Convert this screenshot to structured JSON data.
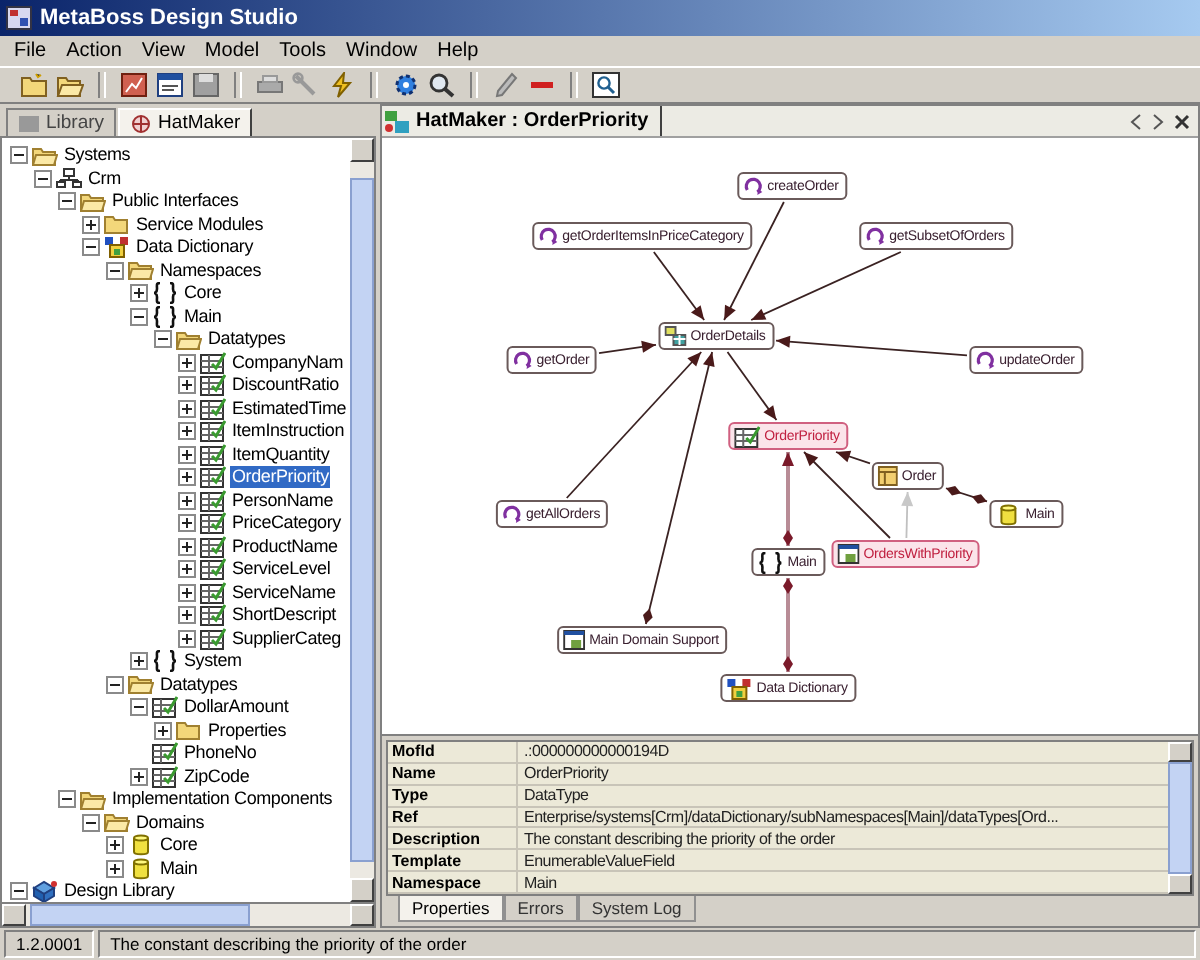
{
  "window": {
    "title": "MetaBoss Design Studio"
  },
  "menu": [
    "File",
    "Action",
    "View",
    "Model",
    "Tools",
    "Window",
    "Help"
  ],
  "left_tabs": [
    {
      "label": "Library",
      "selected": false
    },
    {
      "label": "HatMaker",
      "selected": true
    }
  ],
  "tree": [
    {
      "label": "Systems",
      "kind": "folder",
      "expanded": true,
      "selected": false,
      "children": [
        {
          "label": "Crm",
          "kind": "server",
          "expanded": true,
          "selected": false,
          "children": [
            {
              "label": "Public Interfaces",
              "kind": "folder",
              "expanded": true,
              "selected": false,
              "children": [
                {
                  "label": "Service Modules",
                  "kind": "folder",
                  "expanded": false,
                  "selected": false
                },
                {
                  "label": "Data Dictionary",
                  "kind": "dictionary",
                  "expanded": true,
                  "selected": false,
                  "children": [
                    {
                      "label": "Namespaces",
                      "kind": "folder",
                      "expanded": true,
                      "selected": false,
                      "children": [
                        {
                          "label": "Core",
                          "kind": "namespace",
                          "expanded": false,
                          "selected": false
                        },
                        {
                          "label": "Main",
                          "kind": "namespace",
                          "expanded": true,
                          "selected": false,
                          "children": [
                            {
                              "label": "Datatypes",
                              "kind": "folder",
                              "expanded": true,
                              "selected": false,
                              "children": [
                                {
                                  "label": "CompanyNam",
                                  "kind": "datatype",
                                  "expanded": false,
                                  "selected": false
                                },
                                {
                                  "label": "DiscountRatio",
                                  "kind": "datatype",
                                  "expanded": false,
                                  "selected": false
                                },
                                {
                                  "label": "EstimatedTime",
                                  "kind": "datatype",
                                  "expanded": false,
                                  "selected": false
                                },
                                {
                                  "label": "ItemInstruction",
                                  "kind": "datatype",
                                  "expanded": false,
                                  "selected": false
                                },
                                {
                                  "label": "ItemQuantity",
                                  "kind": "datatype",
                                  "expanded": false,
                                  "selected": false
                                },
                                {
                                  "label": "OrderPriority",
                                  "kind": "datatype",
                                  "expanded": false,
                                  "selected": true
                                },
                                {
                                  "label": "PersonName",
                                  "kind": "datatype",
                                  "expanded": false,
                                  "selected": false
                                },
                                {
                                  "label": "PriceCategory",
                                  "kind": "datatype",
                                  "expanded": false,
                                  "selected": false
                                },
                                {
                                  "label": "ProductName",
                                  "kind": "datatype",
                                  "expanded": false,
                                  "selected": false
                                },
                                {
                                  "label": "ServiceLevel",
                                  "kind": "datatype",
                                  "expanded": false,
                                  "selected": false
                                },
                                {
                                  "label": "ServiceName",
                                  "kind": "datatype",
                                  "expanded": false,
                                  "selected": false
                                },
                                {
                                  "label": "ShortDescript",
                                  "kind": "datatype",
                                  "expanded": false,
                                  "selected": false
                                },
                                {
                                  "label": "SupplierCateg",
                                  "kind": "datatype",
                                  "expanded": false,
                                  "selected": false
                                }
                              ]
                            }
                          ]
                        },
                        {
                          "label": "System",
                          "kind": "namespace",
                          "expanded": false,
                          "selected": false
                        }
                      ]
                    },
                    {
                      "label": "Datatypes",
                      "kind": "folder",
                      "expanded": true,
                      "selected": false,
                      "children": [
                        {
                          "label": "DollarAmount",
                          "kind": "datatype",
                          "expanded": true,
                          "selected": false,
                          "children": [
                            {
                              "label": "Properties",
                              "kind": "folder",
                              "expanded": false,
                              "selected": false
                            }
                          ]
                        },
                        {
                          "label": "PhoneNo",
                          "kind": "datatype",
                          "selected": false
                        },
                        {
                          "label": "ZipCode",
                          "kind": "datatype",
                          "expanded": false,
                          "selected": false
                        }
                      ]
                    }
                  ]
                }
              ]
            },
            {
              "label": "Implementation Components",
              "kind": "folder",
              "expanded": true,
              "selected": false,
              "children": [
                {
                  "label": "Domains",
                  "kind": "folder",
                  "expanded": true,
                  "selected": false,
                  "children": [
                    {
                      "label": "Core",
                      "kind": "database",
                      "expanded": false,
                      "selected": false
                    },
                    {
                      "label": "Main",
                      "kind": "database",
                      "expanded": false,
                      "selected": false
                    }
                  ]
                }
              ]
            }
          ]
        }
      ]
    },
    {
      "label": "Design Library",
      "kind": "library",
      "expanded": true,
      "selected": false
    }
  ],
  "editor": {
    "title": "HatMaker : OrderPriority",
    "nodes": [
      {
        "label": "createOrder",
        "kind": "operation",
        "highlighted": false
      },
      {
        "label": "getOrderItemsInPriceCategory",
        "kind": "operation",
        "highlighted": false
      },
      {
        "label": "getSubsetOfOrders",
        "kind": "operation",
        "highlighted": false
      },
      {
        "label": "OrderDetails",
        "kind": "entity",
        "highlighted": false
      },
      {
        "label": "getOrder",
        "kind": "operation",
        "highlighted": false
      },
      {
        "label": "updateOrder",
        "kind": "operation",
        "highlighted": false
      },
      {
        "label": "OrderPriority",
        "kind": "datatype",
        "highlighted": true
      },
      {
        "label": "Order",
        "kind": "domain-object",
        "highlighted": false
      },
      {
        "label": "Main",
        "kind": "database",
        "highlighted": false
      },
      {
        "label": "getAllOrders",
        "kind": "operation",
        "highlighted": false
      },
      {
        "label": "Main",
        "kind": "namespace",
        "highlighted": false
      },
      {
        "label": "OrdersWithPriority",
        "kind": "component",
        "highlighted": true
      },
      {
        "label": "Main Domain Support",
        "kind": "component",
        "highlighted": false
      },
      {
        "label": "Data Dictionary",
        "kind": "dictionary",
        "highlighted": false
      }
    ]
  },
  "properties": {
    "rows": [
      {
        "name": "MofId",
        "value": ".:000000000000194D"
      },
      {
        "name": "Name",
        "value": "OrderPriority"
      },
      {
        "name": "Type",
        "value": "DataType"
      },
      {
        "name": "Ref",
        "value": "Enterprise/systems[Crm]/dataDictionary/subNamespaces[Main]/dataTypes[Ord..."
      },
      {
        "name": "Description",
        "value": "The constant describing the priority of the order"
      },
      {
        "name": "Template",
        "value": "EnumerableValueField"
      },
      {
        "name": "Namespace",
        "value": "Main"
      }
    ],
    "tabs": [
      {
        "label": "Properties",
        "selected": true
      },
      {
        "label": "Errors",
        "selected": false
      },
      {
        "label": "System Log",
        "selected": false
      }
    ]
  },
  "status_bar": {
    "version": "1.2.0001",
    "message": "The constant describing the priority of the order"
  }
}
